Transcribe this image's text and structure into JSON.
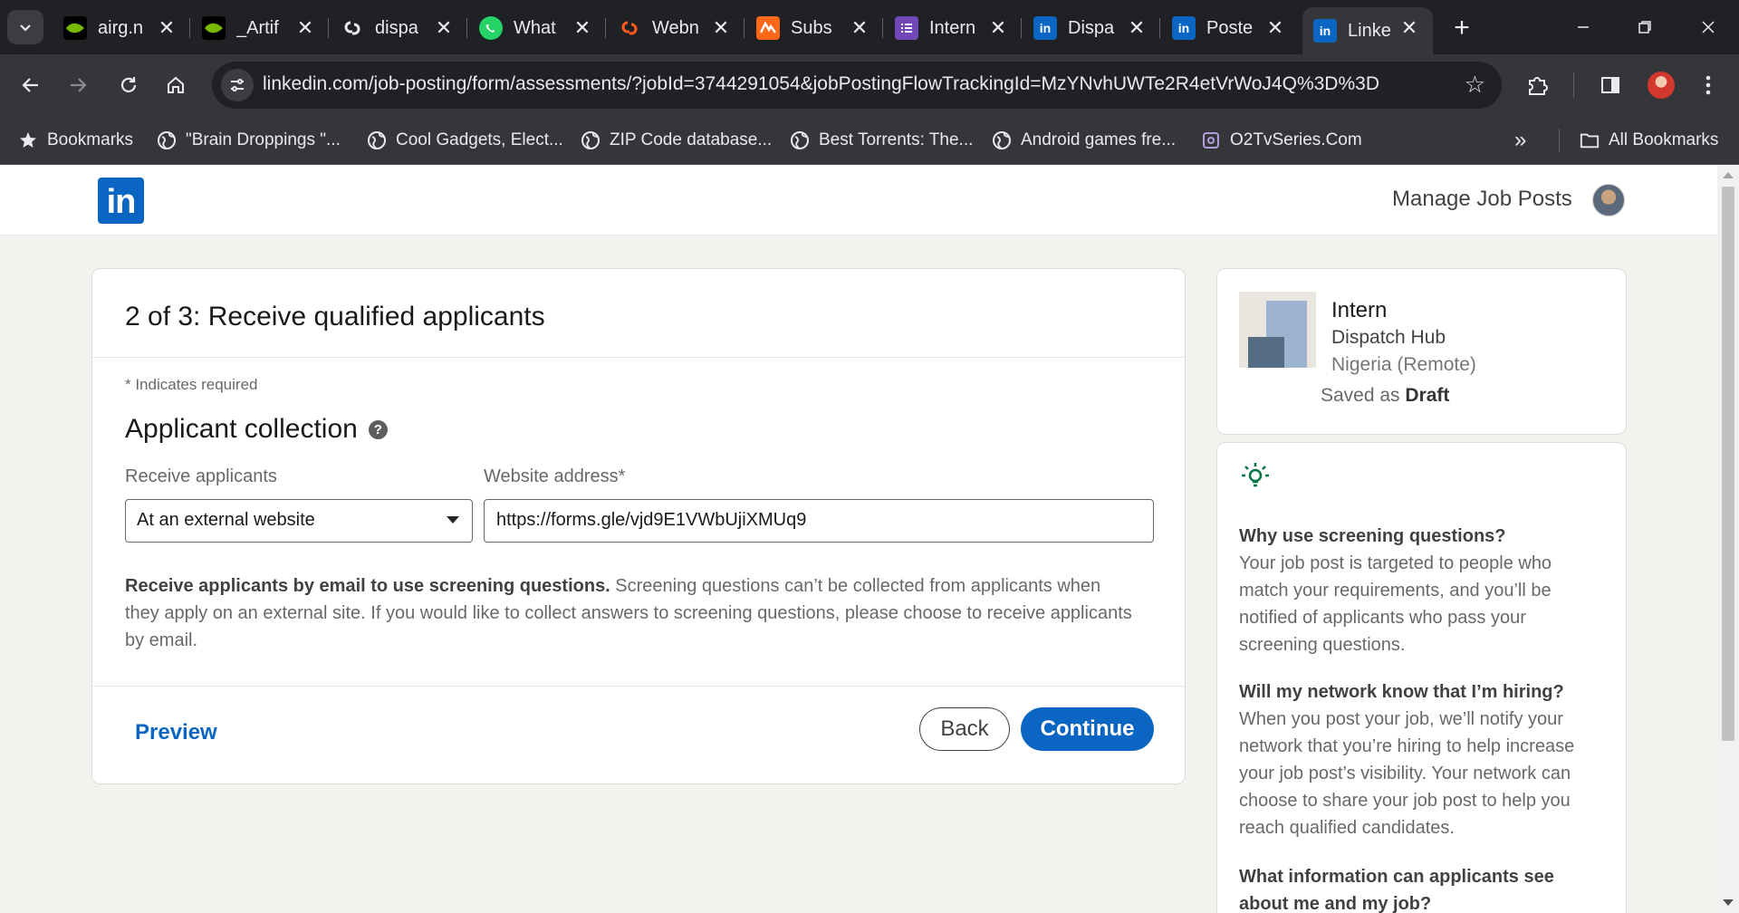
{
  "browser": {
    "tabs": [
      {
        "title": "airg.n",
        "favicon": "nvidia-icon",
        "color": "#000000"
      },
      {
        "title": "_Artif",
        "favicon": "nvidia-icon",
        "color": "#000000"
      },
      {
        "title": "dispa",
        "favicon": "link-icon",
        "color": "#35363a"
      },
      {
        "title": "What",
        "favicon": "whatsapp-icon",
        "color": "#25d366"
      },
      {
        "title": "Webn",
        "favicon": "link-icon",
        "color": "#ff5a1f"
      },
      {
        "title": "Subs",
        "favicon": "substack-icon",
        "color": "#ff6719"
      },
      {
        "title": "Intern",
        "favicon": "forms-icon",
        "color": "#7248b9"
      },
      {
        "title": "Dispa",
        "favicon": "linkedin-icon",
        "color": "#0a66c2"
      },
      {
        "title": "Poste",
        "favicon": "linkedin-icon",
        "color": "#0a66c2"
      },
      {
        "title": "Linke",
        "favicon": "linkedin-icon",
        "color": "#0a66c2"
      }
    ],
    "new_tab": "+",
    "url": "linkedin.com/job-posting/form/assessments/?jobId=3744291054&jobPostingFlowTrackingId=MzYNvhUWTe2R4etVrWoJ4Q%3D%3D",
    "bookmarks": [
      {
        "label": "Bookmarks",
        "icon": "star-icon"
      },
      {
        "label": "\"Brain Droppings \"...",
        "icon": "globe-icon"
      },
      {
        "label": "Cool Gadgets, Elect...",
        "icon": "globe-icon"
      },
      {
        "label": "ZIP Code database...",
        "icon": "globe-icon"
      },
      {
        "label": "Best Torrents: The...",
        "icon": "globe-icon"
      },
      {
        "label": "Android games fre...",
        "icon": "globe-icon"
      },
      {
        "label": "O2TvSeries.Com",
        "icon": "page-icon"
      }
    ],
    "bookmarks_overflow": "»",
    "all_bookmarks": "All Bookmarks"
  },
  "header": {
    "logo": "in",
    "manage_link": "Manage Job Posts"
  },
  "form": {
    "step_title": "2 of 3: Receive qualified applicants",
    "required_note": "* Indicates required",
    "section_title": "Applicant collection",
    "receive_label": "Receive applicants",
    "receive_value": "At an external website",
    "website_label": "Website address*",
    "website_value": "https://forms.gle/vjd9E1VWbUjiXMUq9",
    "info_bold": "Receive applicants by email to use screening questions.",
    "info_text": " Screening questions can’t be collected from applicants when they apply on an external site. If you would like to collect answers to screening questions, please choose to receive applicants by email.",
    "preview": "Preview",
    "back": "Back",
    "continue": "Continue"
  },
  "job": {
    "title": "Intern",
    "company": "Dispatch Hub",
    "location": "Nigeria (Remote)",
    "saved_prefix": "Saved as ",
    "saved_state": "Draft"
  },
  "tips": [
    {
      "question": "Why use screening questions?",
      "answer": "Your job post is targeted to people who match your requirements, and you’ll be notified of applicants who pass your screening questions."
    },
    {
      "question": "Will my network know that I’m hiring?",
      "answer": "When you post your job, we’ll notify your network that you’re hiring to help increase your job post’s visibility. Your network can choose to share your job post to help you reach qualified candidates."
    },
    {
      "question": "What information can applicants see about me and my job?",
      "answer": ""
    }
  ],
  "colors": {
    "brand": "#0a66c2",
    "tip_icon": "#057642"
  }
}
